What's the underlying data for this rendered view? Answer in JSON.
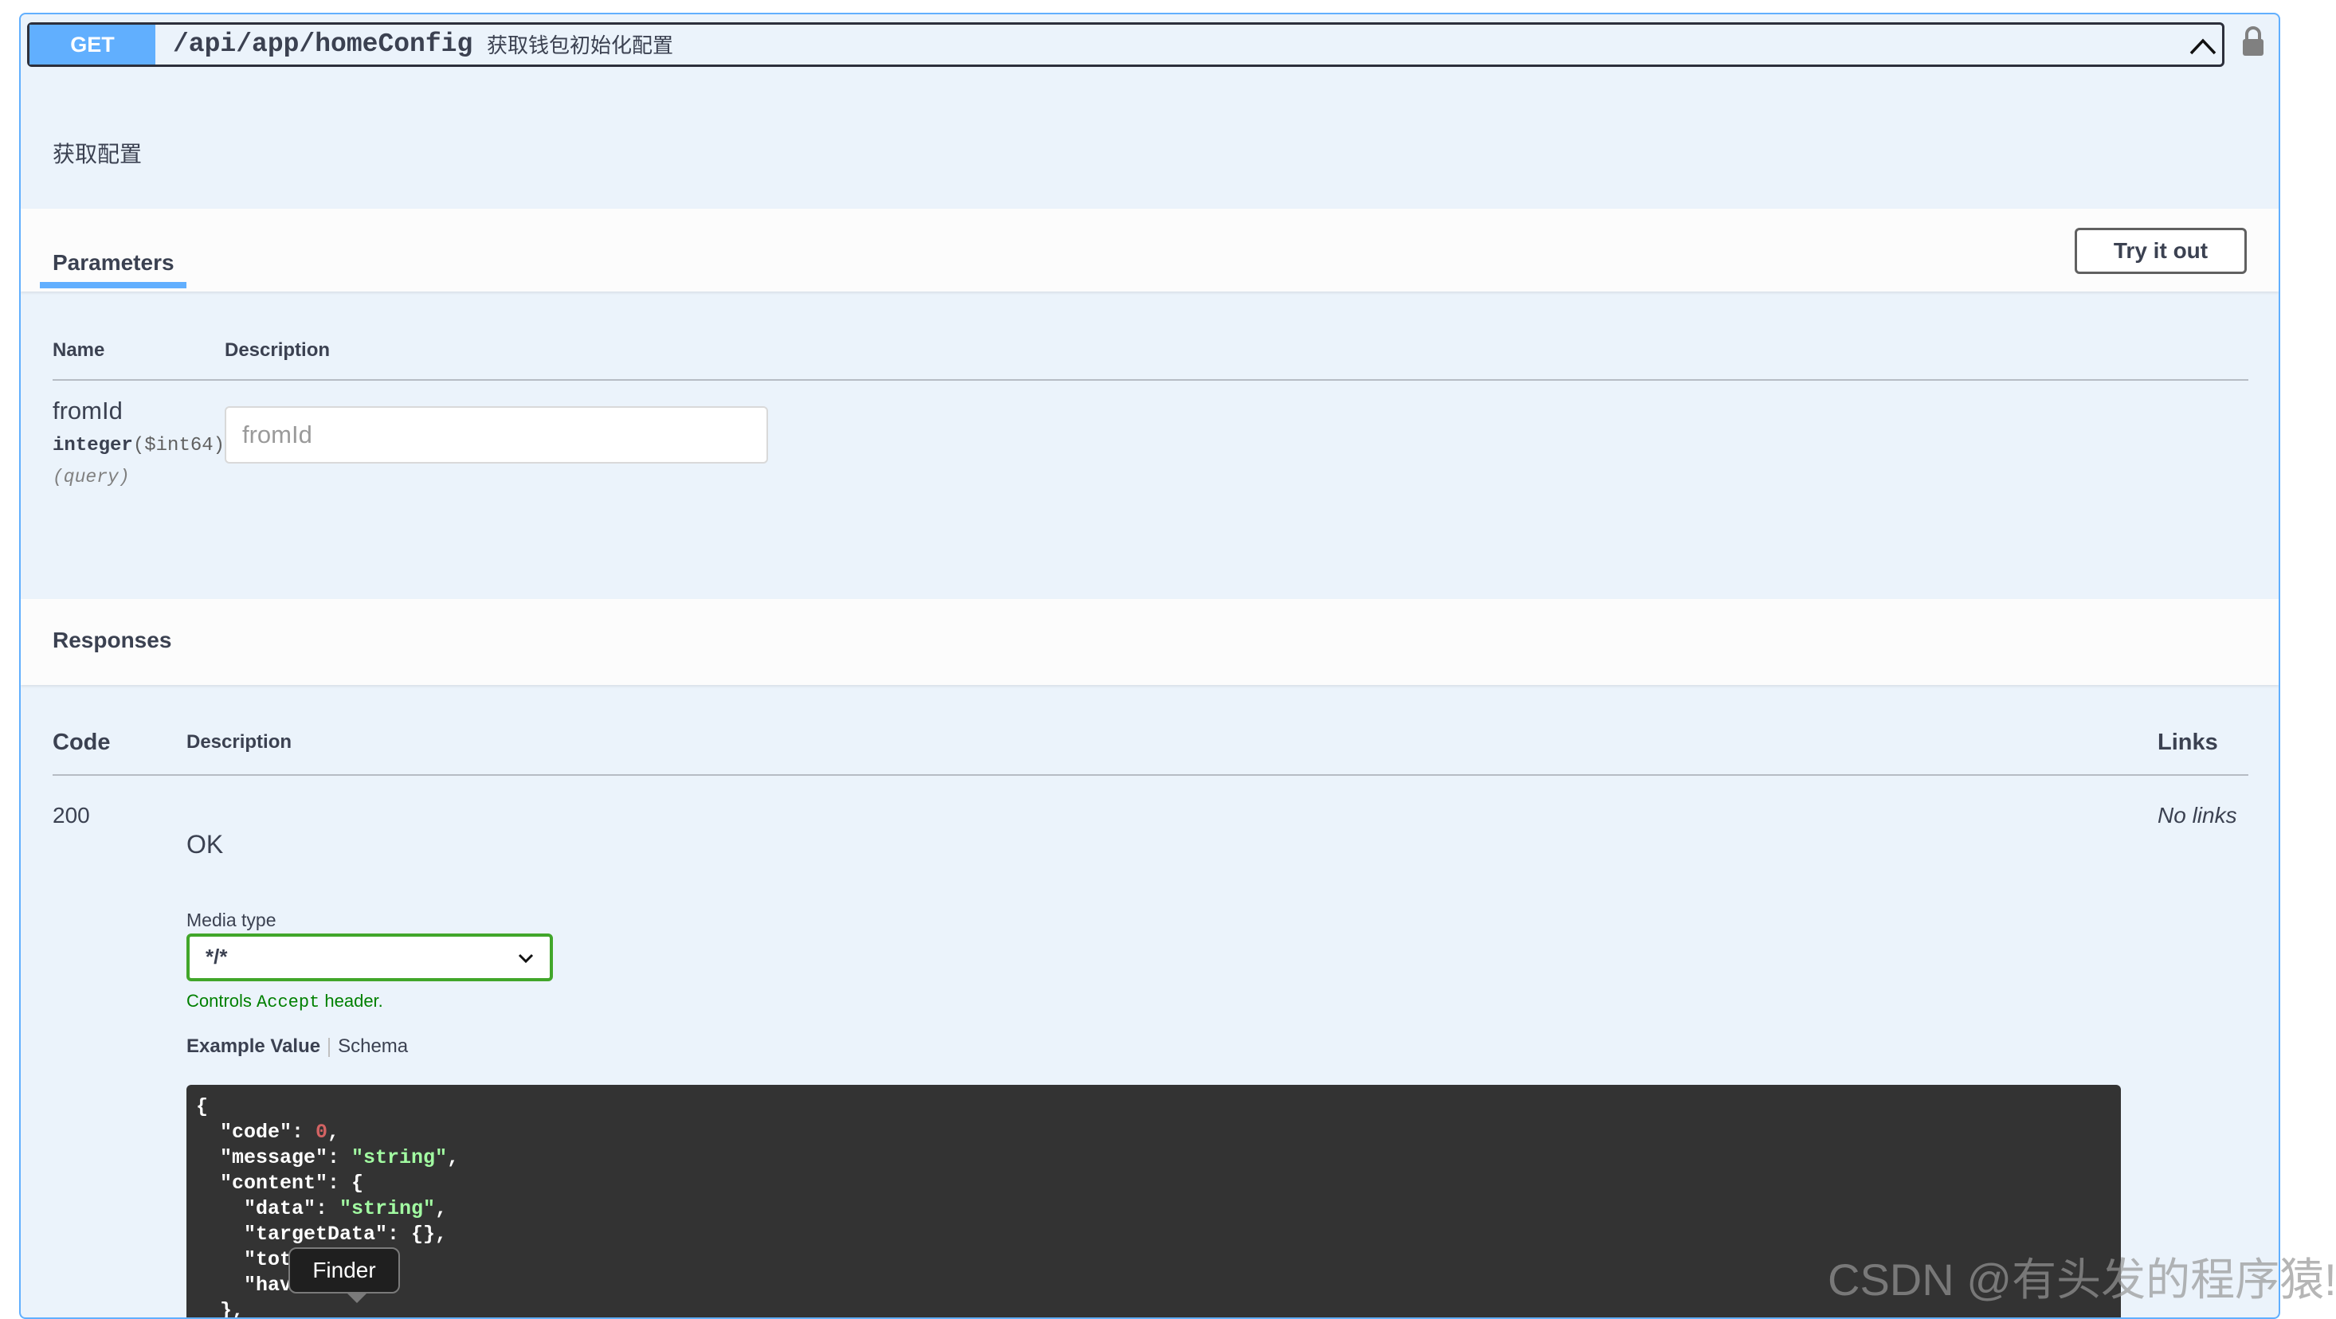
{
  "endpoint": {
    "method": "GET",
    "path": "/api/app/homeConfig",
    "summary": "获取钱包初始化配置",
    "description": "获取配置",
    "chevron_icon": "chevron-up-icon",
    "lock_icon": "lock-icon"
  },
  "parameters": {
    "tab_label": "Parameters",
    "try_button_label": "Try it out",
    "header_name": "Name",
    "header_description": "Description",
    "items": [
      {
        "name": "fromId",
        "type": "integer",
        "format": "($int64)",
        "in": "(query)",
        "placeholder": "fromId"
      }
    ]
  },
  "responses": {
    "title": "Responses",
    "header_code": "Code",
    "header_description": "Description",
    "header_links": "Links",
    "rows": [
      {
        "code": "200",
        "description": "OK",
        "links": "No links",
        "media_type_label": "Media type",
        "media_type_value": "*/*",
        "controls_prefix": "Controls ",
        "controls_accept": "Accept",
        "controls_suffix": " header.",
        "example_tab": "Example Value",
        "schema_tab": "Schema"
      }
    ]
  },
  "code_sample": [
    "{",
    "  \"code\": 0,",
    "  \"message\": \"string\",",
    "  \"content\": {",
    "    \"data\": \"string\",",
    "    \"targetData\": {},",
    "    \"total\": 0,",
    "    \"haveM",
    "  },"
  ],
  "tooltip": {
    "text": "Finder"
  },
  "watermark": "CSDN @有头发的程序猿!",
  "colors": {
    "get_accent": "#61affe",
    "block_background": "#ebf3fb",
    "code_background": "#333333",
    "select_border": "#41a62a",
    "code_number": "#d36363",
    "code_string": "#a2fca2"
  }
}
